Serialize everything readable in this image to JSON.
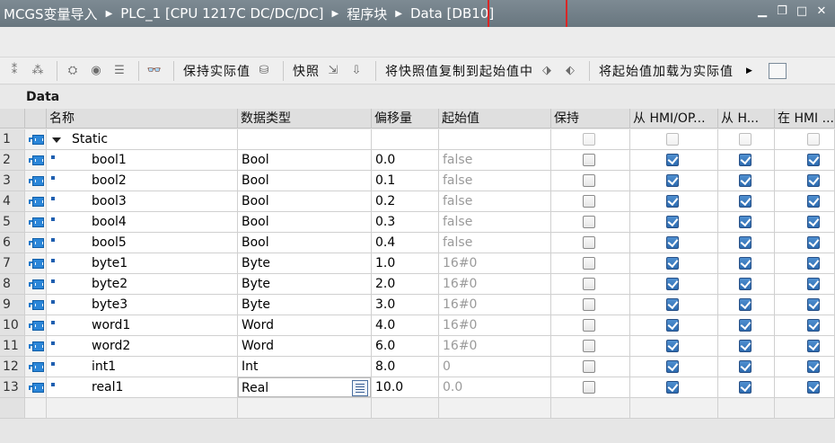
{
  "breadcrumb": [
    "MCGS变量导入",
    "PLC_1 [CPU 1217C DC/DC/DC]",
    "程序块",
    "Data [DB10]"
  ],
  "window_buttons": [
    "minimize-icon",
    "restore-icon",
    "maximize-icon",
    "close-icon"
  ],
  "toolbar": {
    "keep_actual": "保持实际值",
    "snapshot": "快照",
    "copy_snapshot": "将快照值复制到起始值中",
    "load_start": "将起始值加载为实际值"
  },
  "block_title": "Data",
  "columns": {
    "name": "名称",
    "datatype": "数据类型",
    "offset": "偏移量",
    "start": "起始值",
    "retain": "保持",
    "hmi_access": "从 HMI/OP...",
    "hmi_write": "从 H...",
    "hmi_visible": "在 HMI ..."
  },
  "rows": [
    {
      "num": "1",
      "name": "Static",
      "type": "",
      "offset": "",
      "start": "",
      "retain": false,
      "hmi1": false,
      "hmi2": false,
      "hmi3": false,
      "top": true
    },
    {
      "num": "2",
      "name": "bool1",
      "type": "Bool",
      "offset": "0.0",
      "start": "false",
      "retain": false,
      "hmi1": true,
      "hmi2": true,
      "hmi3": true
    },
    {
      "num": "3",
      "name": "bool2",
      "type": "Bool",
      "offset": "0.1",
      "start": "false",
      "retain": false,
      "hmi1": true,
      "hmi2": true,
      "hmi3": true
    },
    {
      "num": "4",
      "name": "bool3",
      "type": "Bool",
      "offset": "0.2",
      "start": "false",
      "retain": false,
      "hmi1": true,
      "hmi2": true,
      "hmi3": true
    },
    {
      "num": "5",
      "name": "bool4",
      "type": "Bool",
      "offset": "0.3",
      "start": "false",
      "retain": false,
      "hmi1": true,
      "hmi2": true,
      "hmi3": true
    },
    {
      "num": "6",
      "name": "bool5",
      "type": "Bool",
      "offset": "0.4",
      "start": "false",
      "retain": false,
      "hmi1": true,
      "hmi2": true,
      "hmi3": true
    },
    {
      "num": "7",
      "name": "byte1",
      "type": "Byte",
      "offset": "1.0",
      "start": "16#0",
      "retain": false,
      "hmi1": true,
      "hmi2": true,
      "hmi3": true
    },
    {
      "num": "8",
      "name": "byte2",
      "type": "Byte",
      "offset": "2.0",
      "start": "16#0",
      "retain": false,
      "hmi1": true,
      "hmi2": true,
      "hmi3": true
    },
    {
      "num": "9",
      "name": "byte3",
      "type": "Byte",
      "offset": "3.0",
      "start": "16#0",
      "retain": false,
      "hmi1": true,
      "hmi2": true,
      "hmi3": true
    },
    {
      "num": "10",
      "name": "word1",
      "type": "Word",
      "offset": "4.0",
      "start": "16#0",
      "retain": false,
      "hmi1": true,
      "hmi2": true,
      "hmi3": true
    },
    {
      "num": "11",
      "name": "word2",
      "type": "Word",
      "offset": "6.0",
      "start": "16#0",
      "retain": false,
      "hmi1": true,
      "hmi2": true,
      "hmi3": true
    },
    {
      "num": "12",
      "name": "int1",
      "type": "Int",
      "offset": "8.0",
      "start": "0",
      "retain": false,
      "hmi1": true,
      "hmi2": true,
      "hmi3": true
    },
    {
      "num": "13",
      "name": "real1",
      "type": "Real",
      "offset": "10.0",
      "start": "0.0",
      "retain": false,
      "hmi1": true,
      "hmi2": true,
      "hmi3": true,
      "editing": true
    }
  ]
}
